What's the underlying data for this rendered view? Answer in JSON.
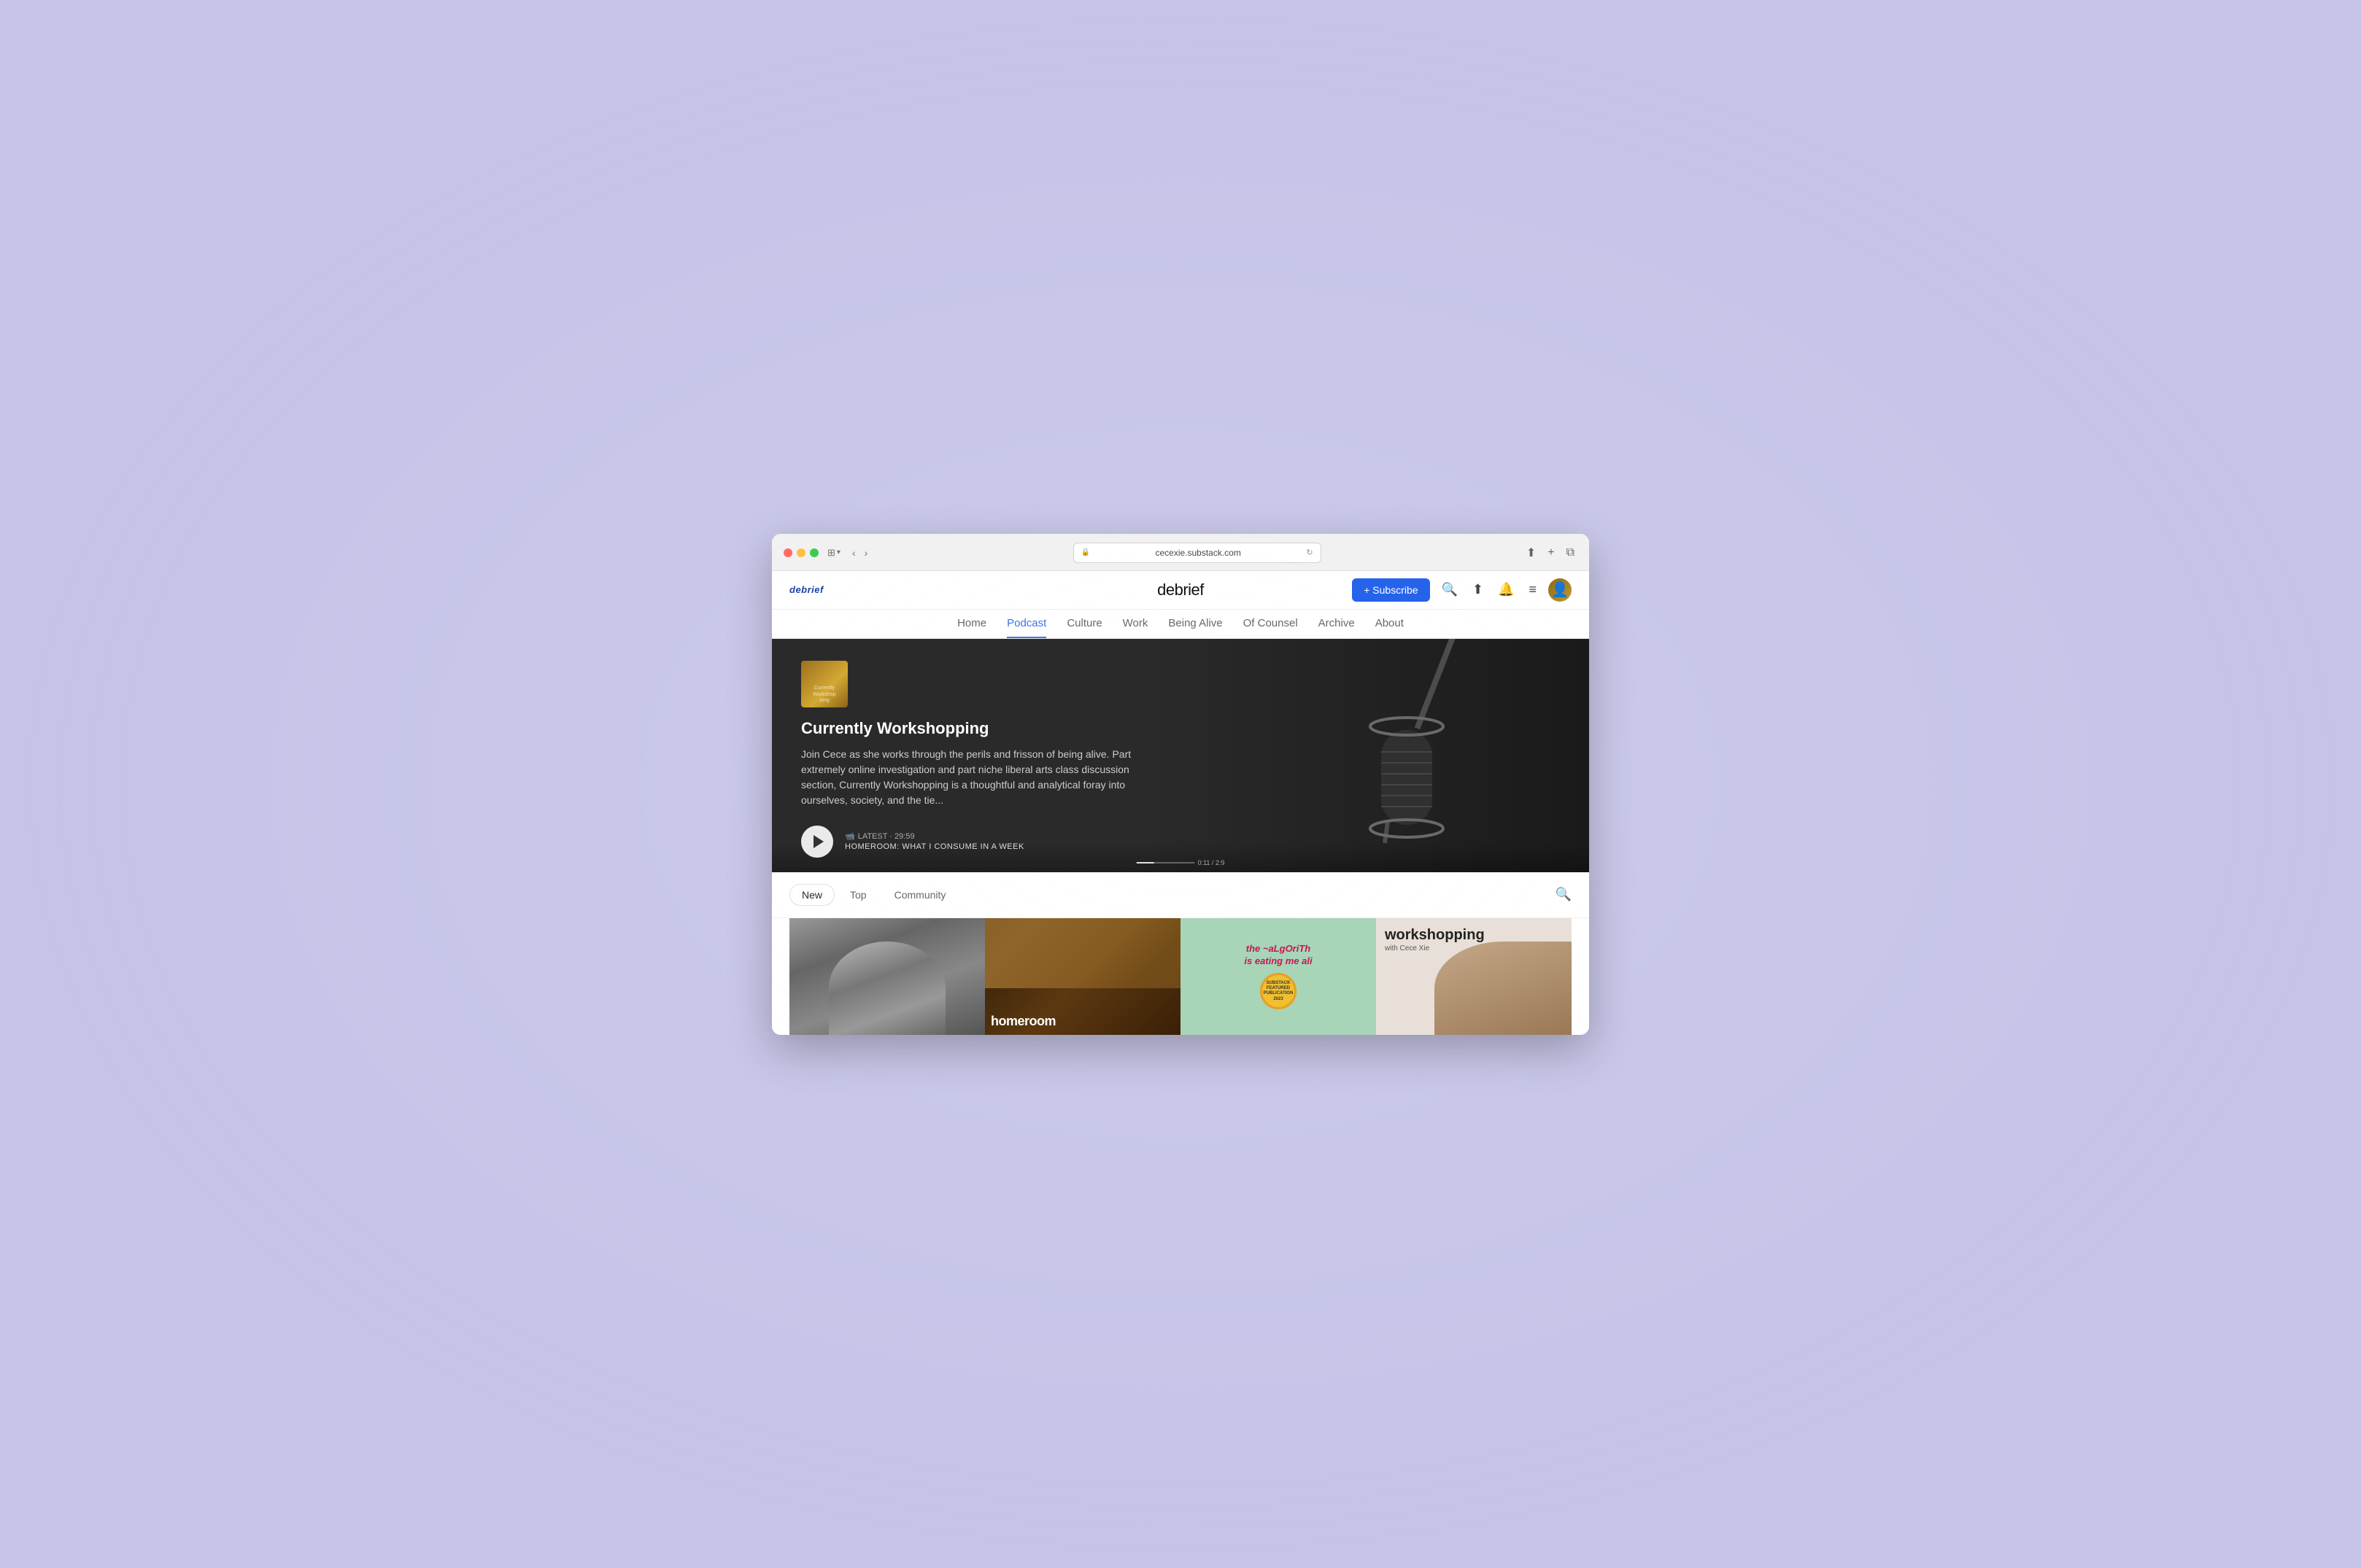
{
  "browser": {
    "url": "cecexie.substack.com",
    "tab_label": "debrief"
  },
  "site": {
    "logo": "debrief",
    "title": "debrief",
    "subscribe_btn": "+ Subscribe"
  },
  "nav_tabs": [
    {
      "id": "home",
      "label": "Home",
      "active": false
    },
    {
      "id": "podcast",
      "label": "Podcast",
      "active": true
    },
    {
      "id": "culture",
      "label": "Culture",
      "active": false
    },
    {
      "id": "work",
      "label": "Work",
      "active": false
    },
    {
      "id": "being-alive",
      "label": "Being Alive",
      "active": false
    },
    {
      "id": "of-counsel",
      "label": "Of Counsel",
      "active": false
    },
    {
      "id": "archive",
      "label": "Archive",
      "active": false
    },
    {
      "id": "about",
      "label": "About",
      "active": false
    }
  ],
  "hero": {
    "podcast_title": "Currently Workshopping",
    "description": "Join Cece as she works through the perils and frisson of being alive. Part extremely online investigation and part niche liberal arts class discussion section, Currently Workshopping is a thoughtful and analytical foray into ourselves, society, and the tie...",
    "latest_label": "LATEST · 29:59",
    "episode_title": "HOMEROOM: WHAT I CONSUME IN A WEEK",
    "progress": "0:11 / 2:9"
  },
  "filter": {
    "tabs": [
      {
        "id": "new",
        "label": "New",
        "active": true
      },
      {
        "id": "top",
        "label": "Top",
        "active": false
      },
      {
        "id": "community",
        "label": "Community",
        "active": false
      }
    ]
  },
  "posts": [
    {
      "id": 1,
      "type": "bw-person"
    },
    {
      "id": 2,
      "type": "homeroom",
      "overlay_text": "homeroom"
    },
    {
      "id": 3,
      "type": "algorithm",
      "text": "the ~aLgOriTh\nis eating me ali",
      "badge": "SUBSTACK\nFEATURED\nPUBLICATION\n2023"
    },
    {
      "id": 4,
      "type": "workshopping",
      "title": "workshopping",
      "subtitle": "with Cece Xie"
    }
  ]
}
